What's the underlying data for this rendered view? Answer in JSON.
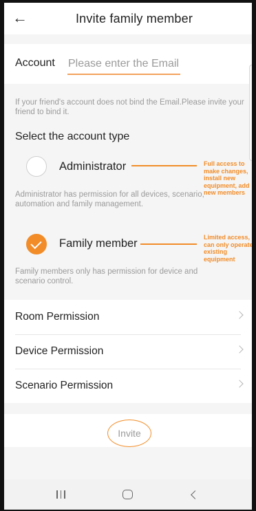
{
  "header": {
    "title": "Invite family member",
    "back_icon": "arrow-left-icon"
  },
  "account": {
    "label": "Account",
    "placeholder": "Please enter the Email",
    "value": ""
  },
  "hint": "If your friend's account does not bind the Email.Please invite your friend to bind it.",
  "account_type": {
    "title": "Select the account type",
    "options": [
      {
        "label": "Administrator",
        "description": "Administrator has permission for all devices, scenario, automation and family management.",
        "selected": false,
        "annotation": "Full access to make changes, install new equipment, add new members"
      },
      {
        "label": "Family member",
        "description": "Family members only has permission for device and scenario control.",
        "selected": true,
        "annotation": "Limited access, can only operate existing equipment"
      }
    ]
  },
  "permissions": [
    {
      "label": "Room Permission"
    },
    {
      "label": "Device Permission"
    },
    {
      "label": "Scenario Permission"
    }
  ],
  "invite_button": "Invite",
  "colors": {
    "accent": "#f28c28",
    "text": "#222222",
    "muted": "#9a9a9a",
    "background": "#f5f5f5"
  },
  "nav_icons": [
    "recent-apps-icon",
    "home-icon",
    "back-icon"
  ]
}
